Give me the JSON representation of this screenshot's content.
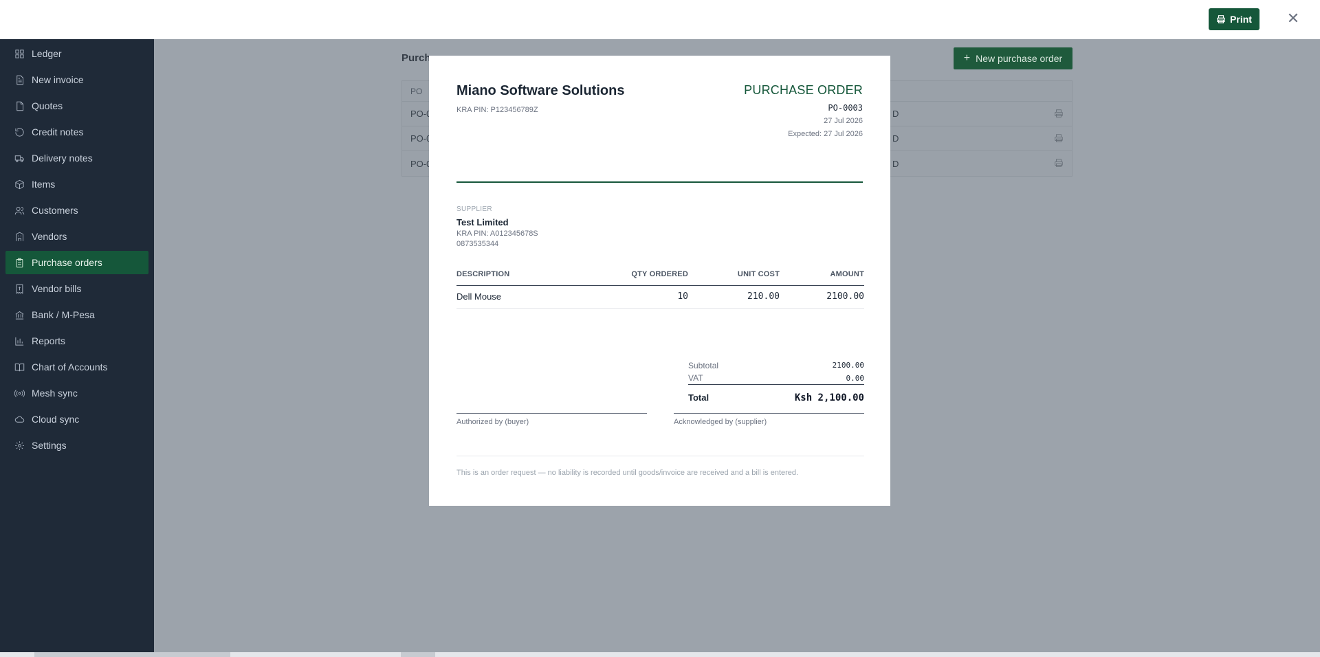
{
  "topbar": {
    "print_label": "Print",
    "close_glyph": "✕"
  },
  "sidebar": {
    "items": [
      {
        "label": "Ledger",
        "icon": "grid-icon"
      },
      {
        "label": "New invoice",
        "icon": "document-icon"
      },
      {
        "label": "Quotes",
        "icon": "file-icon"
      },
      {
        "label": "Credit notes",
        "icon": "rotate-icon"
      },
      {
        "label": "Delivery notes",
        "icon": "truck-icon"
      },
      {
        "label": "Items",
        "icon": "box-icon"
      },
      {
        "label": "Customers",
        "icon": "users-icon"
      },
      {
        "label": "Vendors",
        "icon": "building-icon"
      },
      {
        "label": "Purchase orders",
        "icon": "clipboard-icon",
        "active": true
      },
      {
        "label": "Vendor bills",
        "icon": "receipt-icon"
      },
      {
        "label": "Bank / M-Pesa",
        "icon": "bank-icon"
      },
      {
        "label": "Reports",
        "icon": "bar-chart-icon"
      },
      {
        "label": "Chart of Accounts",
        "icon": "book-icon"
      },
      {
        "label": "Mesh sync",
        "icon": "broadcast-icon"
      },
      {
        "label": "Cloud sync",
        "icon": "cloud-icon"
      },
      {
        "label": "Settings",
        "icon": "gear-icon"
      }
    ]
  },
  "background": {
    "page_title": "Purch",
    "page_title_tail": "...",
    "new_po_label": "New purchase order",
    "table_header": "PO",
    "rows": [
      {
        "prefix": "PO-0",
        "tail": "D"
      },
      {
        "prefix": "PO-0",
        "tail": "D"
      },
      {
        "prefix": "PO-0",
        "tail": "D"
      }
    ]
  },
  "document": {
    "company": "Miano Software Solutions",
    "company_pin": "KRA PIN: P123456789Z",
    "title": "PURCHASE ORDER",
    "po_number": "PO-0003",
    "date": "27 Jul 2026",
    "expected": "Expected: 27 Jul 2026",
    "supplier_label": "SUPPLIER",
    "supplier_name": "Test Limited",
    "supplier_pin": "KRA PIN: A012345678S",
    "supplier_phone": "0873535344",
    "columns": {
      "description": "DESCRIPTION",
      "qty": "QTY ORDERED",
      "unit_cost": "UNIT COST",
      "amount": "AMOUNT"
    },
    "lines": [
      {
        "description": "Dell Mouse",
        "qty": "10",
        "unit_cost": "210.00",
        "amount": "2100.00"
      }
    ],
    "totals": {
      "subtotal_label": "Subtotal",
      "subtotal": "2100.00",
      "vat_label": "VAT",
      "vat": "0.00",
      "total_label": "Total",
      "total": "Ksh 2,100.00"
    },
    "signatures": {
      "buyer": "Authorized by (buyer)",
      "supplier": "Acknowledged by (supplier)"
    },
    "footer_note": "This is an order request — no liability is recorded until goods/invoice are received and a bill is entered."
  },
  "colors": {
    "brand_green": "#15573a",
    "sidebar_bg": "#1f2a38",
    "overlay_bg": "#9ca3ab"
  }
}
